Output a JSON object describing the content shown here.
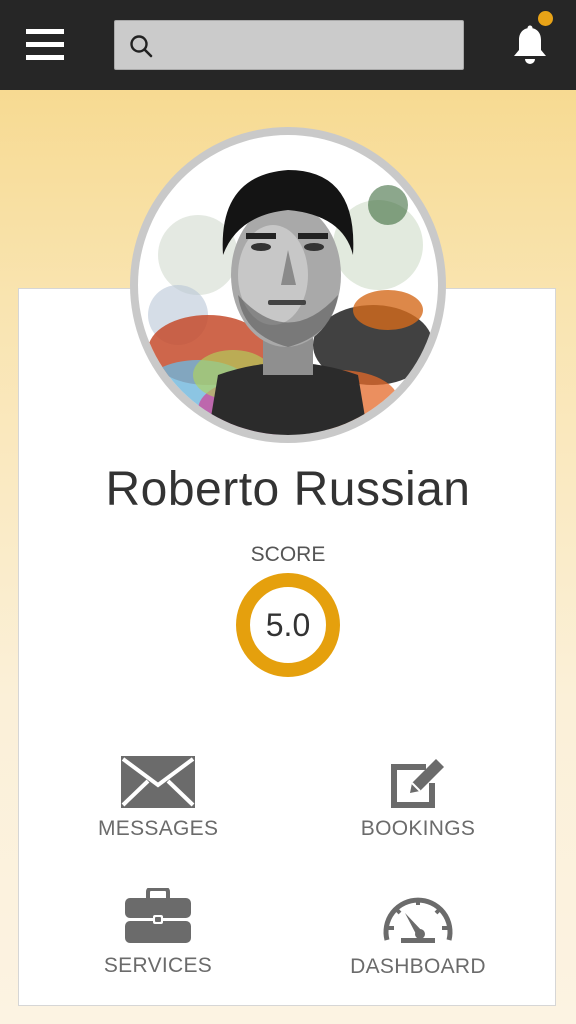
{
  "topbar": {
    "menu_icon": "hamburger-menu-icon",
    "search": {
      "placeholder": "",
      "value": "",
      "icon": "search-icon"
    },
    "notifications": {
      "icon": "bell-icon",
      "has_unread": true,
      "badge_color": "#e8a317"
    }
  },
  "profile": {
    "name": "Roberto Russian",
    "score_label": "SCORE",
    "score_value": "5.0",
    "score_ring_color": "#e5a00d"
  },
  "actions": [
    {
      "label": "MESSAGES",
      "icon": "envelope-icon"
    },
    {
      "label": "BOOKINGS",
      "icon": "edit-icon"
    },
    {
      "label": "SERVICES",
      "icon": "briefcase-icon"
    },
    {
      "label": "DASHBOARD",
      "icon": "speedometer-icon"
    }
  ],
  "colors": {
    "topbar_bg": "#262626",
    "accent": "#e5a00d",
    "icon_gray": "#6b6b6b"
  }
}
